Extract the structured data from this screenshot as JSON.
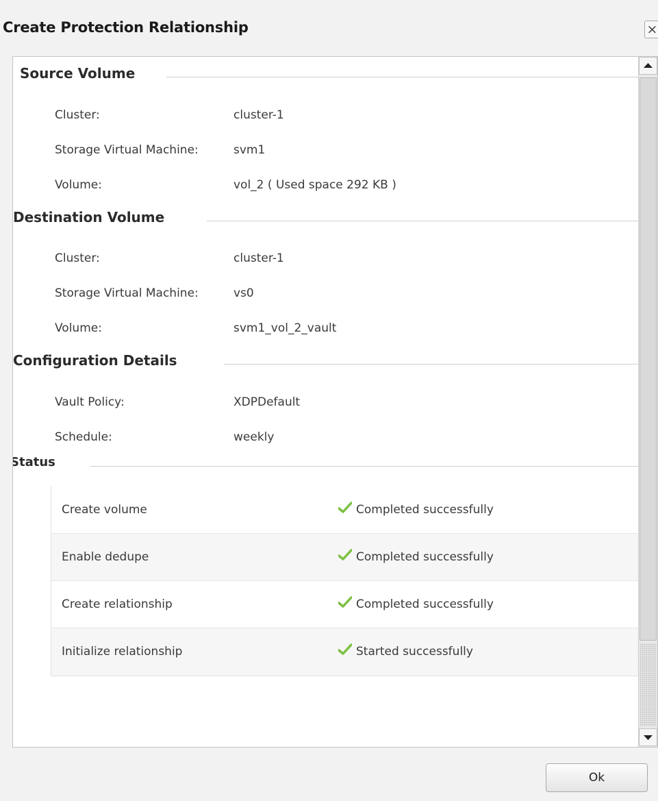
{
  "dialog": {
    "title": "Create Protection Relationship",
    "close_glyph": "×",
    "ok_label": "Ok"
  },
  "source": {
    "header": "Source Volume",
    "fields": [
      {
        "label": "Cluster:",
        "value": "cluster-1"
      },
      {
        "label": "Storage Virtual Machine:",
        "value": "svm1"
      },
      {
        "label": "Volume:",
        "value": "vol_2 ( Used space 292 KB )"
      }
    ]
  },
  "destination": {
    "header": "Destination Volume",
    "fields": [
      {
        "label": "Cluster:",
        "value": "cluster-1"
      },
      {
        "label": "Storage Virtual Machine:",
        "value": "vs0"
      },
      {
        "label": "Volume:",
        "value": "svm1_vol_2_vault"
      }
    ]
  },
  "configuration": {
    "header": "Configuration Details",
    "fields": [
      {
        "label": "Vault Policy:",
        "value": "XDPDefault"
      },
      {
        "label": "Schedule:",
        "value": "weekly"
      }
    ]
  },
  "status": {
    "header": "Status",
    "rows": [
      {
        "step": "Create volume",
        "result": "Completed successfully",
        "icon": "check-icon"
      },
      {
        "step": "Enable dedupe",
        "result": "Completed successfully",
        "icon": "check-icon"
      },
      {
        "step": "Create relationship",
        "result": "Completed successfully",
        "icon": "check-icon"
      },
      {
        "step": "Initialize relationship",
        "result": "Started successfully",
        "icon": "check-icon"
      }
    ]
  },
  "colors": {
    "check": "#7cc142"
  }
}
